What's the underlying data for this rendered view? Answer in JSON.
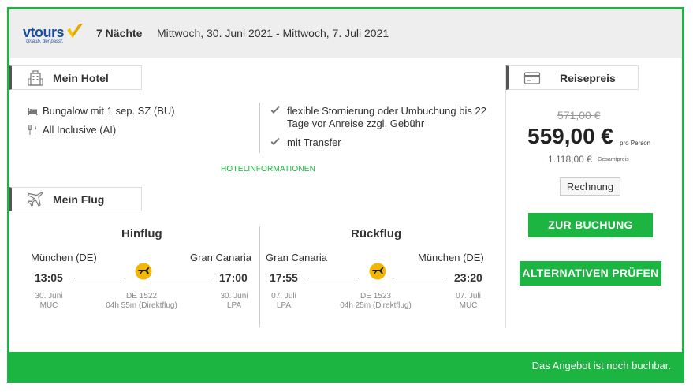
{
  "header": {
    "logo_text": "vtours",
    "logo_tagline": "Urlaub, der passt.",
    "nights": "7 Nächte",
    "dates": "Mittwoch, 30. Juni 2021 - Mittwoch, 7. Juli 2021"
  },
  "hotel": {
    "section_title": "Mein Hotel",
    "room": "Bungalow mit 1 sep. SZ (BU)",
    "board": "All Inclusive (AI)",
    "benefits": [
      "flexible Stornierung oder Umbuchung bis 22",
      "Tage vor Anreise zzgl. Gebühr",
      "mit Transfer"
    ],
    "info_link": "HOTELINFORMATIONEN"
  },
  "flight": {
    "section_title": "Mein Flug",
    "outbound": {
      "title": "Hinflug",
      "from_city": "München (DE)",
      "to_city": "Gran Canaria",
      "dep_time": "13:05",
      "arr_time": "17:00",
      "dep_date": "30. Juni",
      "dep_code": "MUC",
      "arr_date": "30. Juni",
      "arr_code": "LPA",
      "flight_no": "DE 1522",
      "duration": "04h 55m (Direktflug)"
    },
    "return": {
      "title": "Rückflug",
      "from_city": "Gran Canaria",
      "to_city": "München (DE)",
      "dep_time": "17:55",
      "arr_time": "23:20",
      "dep_date": "07. Juli",
      "dep_code": "LPA",
      "arr_date": "07. Juli",
      "arr_code": "MUC",
      "flight_no": "DE 1523",
      "duration": "04h 25m (Direktflug)"
    }
  },
  "price": {
    "section_title": "Reisepreis",
    "old_price": "571,00 €",
    "main_price": "559,00 €",
    "per_person": "pro Person",
    "total": "1.118,00 €",
    "total_label": "Gesamtpreis",
    "invoice_label": "Rechnung",
    "book_label": "ZUR BUCHUNG",
    "alt_label": "ALTERNATIVEN PRÜFEN"
  },
  "footer": {
    "status": "Das Angebot ist noch buchbar."
  },
  "colors": {
    "accent_green": "#1db542",
    "logo_blue": "#1a4f9c",
    "logo_yellow": "#f5c400",
    "airline_yellow": "#f2b705"
  },
  "icons": [
    "vtours-check-logo",
    "hotel-building-icon",
    "bed-icon",
    "cutlery-icon",
    "checkmark-icon",
    "plane-icon",
    "airline-logo-icon",
    "credit-card-icon"
  ]
}
